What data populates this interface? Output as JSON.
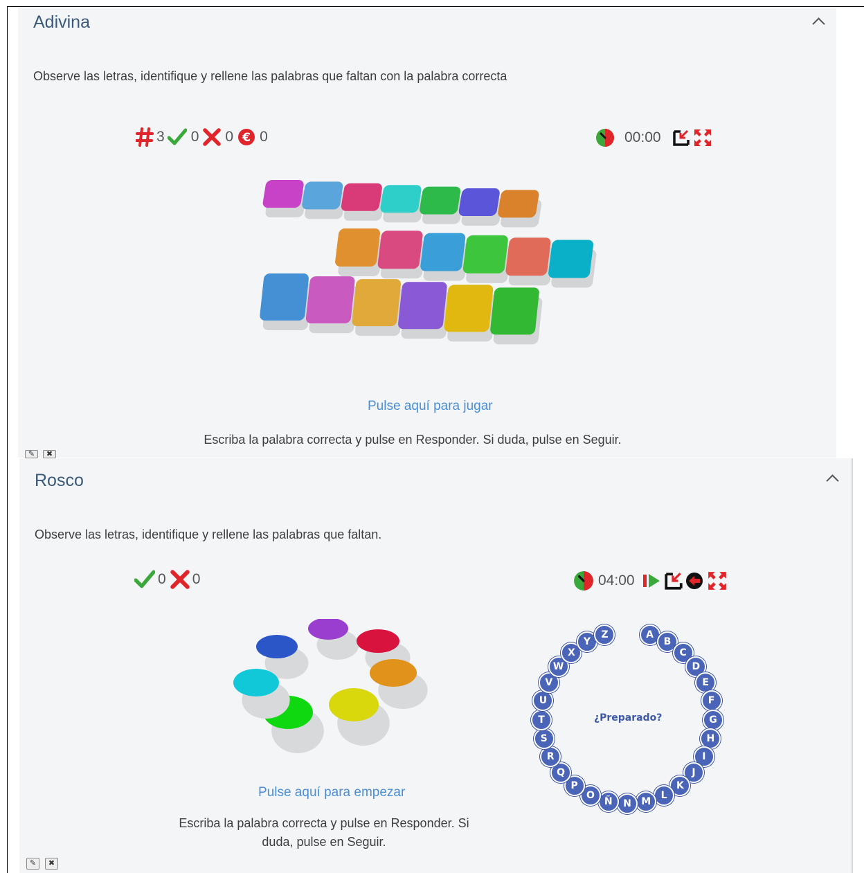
{
  "adivina": {
    "title": "Adivina",
    "description": "Observe las letras, identifique y rellene las palabras que faltan con la palabra correcta",
    "stats": {
      "number": "3",
      "correct": "0",
      "wrong": "0",
      "score": "0"
    },
    "timer": "00:00",
    "play_link": "Pulse aquí para jugar",
    "instructions": "Escriba la palabra correcta y pulse en Responder. Si duda, pulse en Seguir.",
    "card_colors": [
      "#c842c8",
      "#5aa5dc",
      "#d93a78",
      "#2dcfc8",
      "#2dba4a",
      "#5a55d9",
      "#d9822b",
      "#e0902e",
      "#d94a80",
      "#3a9fd9",
      "#3dc63d",
      "#e06b58",
      "#0ab0c8",
      "#4590d4",
      "#c85ac0",
      "#e0a93a",
      "#8a5ad6",
      "#e0b80f",
      "#33b833"
    ],
    "icons": [
      "hash-icon",
      "check-icon",
      "cross-icon",
      "score-icon",
      "clock-icon",
      "minimize-icon",
      "fullscreen-icon",
      "edit-icon",
      "delete-icon"
    ]
  },
  "rosco": {
    "title": "Rosco",
    "description": "Observe las letras, identifique y rellene las palabras que faltan.",
    "stats": {
      "correct": "0",
      "wrong": "0"
    },
    "timer": "04:00",
    "start_link": "Pulse aquí para empezar",
    "instructions": "Escriba la palabra correcta y pulse en Responder. Si duda, pulse en Seguir.",
    "center_text": "¿Preparado?",
    "letters": [
      "A",
      "B",
      "C",
      "D",
      "E",
      "F",
      "G",
      "H",
      "I",
      "J",
      "K",
      "L",
      "M",
      "N",
      "Ñ",
      "O",
      "P",
      "Q",
      "R",
      "S",
      "T",
      "U",
      "V",
      "W",
      "X",
      "Y",
      "Z"
    ],
    "disc_colors": [
      "#2b56c8",
      "#9a3ed0",
      "#d8143e",
      "#e0921a",
      "#d8d80c",
      "#10d810",
      "#10c8d8"
    ],
    "icons": [
      "check-icon",
      "cross-icon",
      "clock-icon",
      "play-next-icon",
      "minimize-icon",
      "reload-icon",
      "fullscreen-icon",
      "edit-icon",
      "delete-icon"
    ]
  }
}
